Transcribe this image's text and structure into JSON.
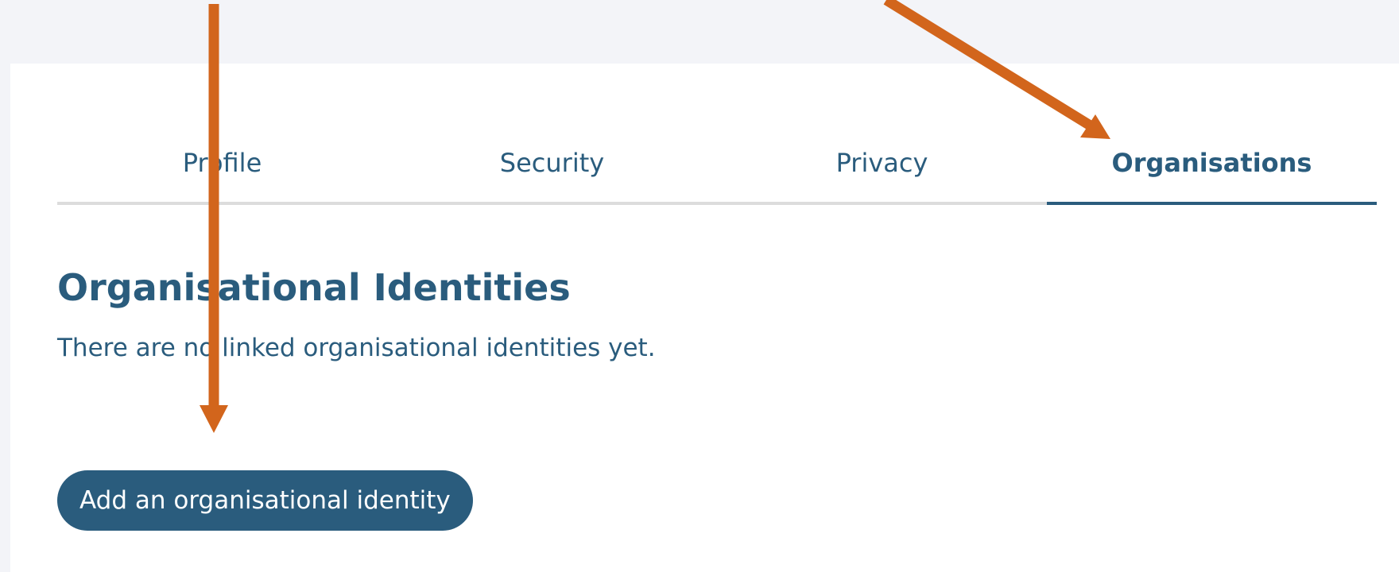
{
  "tabs": [
    {
      "label": "Profile",
      "active": false
    },
    {
      "label": "Security",
      "active": false
    },
    {
      "label": "Privacy",
      "active": false
    },
    {
      "label": "Organisations",
      "active": true
    }
  ],
  "section": {
    "heading": "Organisational Identities",
    "empty_message": "There are no linked organisational identities yet."
  },
  "actions": {
    "add_identity_label": "Add an organisational identity"
  },
  "colors": {
    "page_background": "#f3f4f8",
    "card_background": "#ffffff",
    "primary": "#2a5c7d",
    "annotation_arrow": "#d2651c"
  }
}
